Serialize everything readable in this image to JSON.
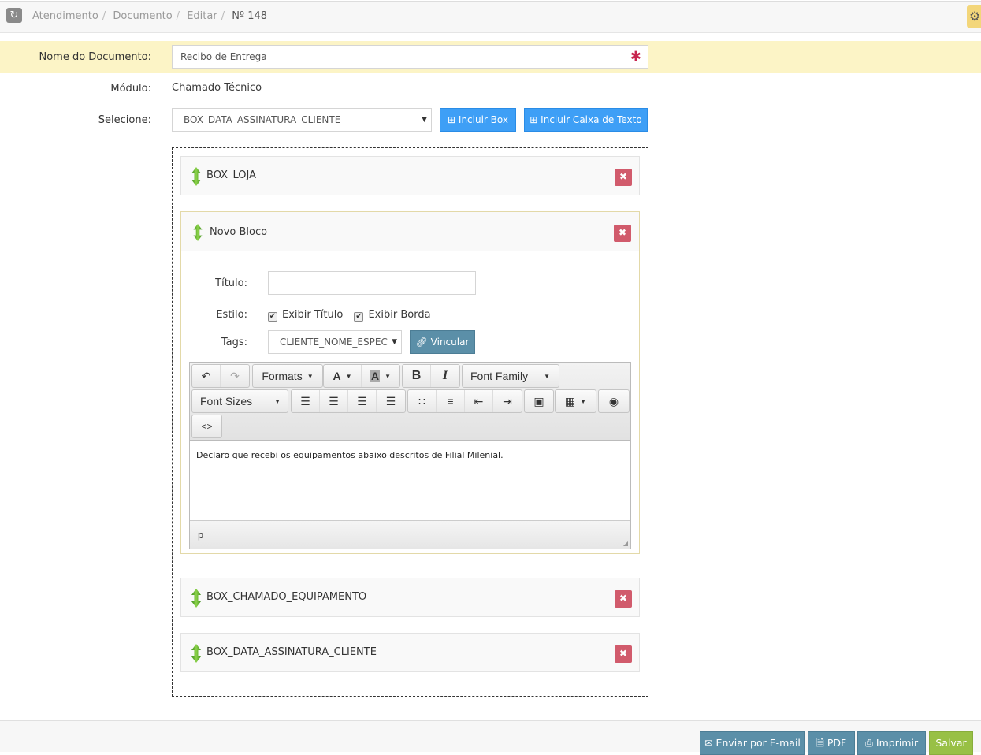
{
  "breadcrumb": {
    "items": [
      "Atendimento",
      "Documento",
      "Editar"
    ],
    "current": "Nº 148"
  },
  "form": {
    "nome_label": "Nome do Documento:",
    "nome_value": "Recibo de Entrega",
    "modulo_label": "Módulo:",
    "modulo_value": "Chamado Técnico",
    "selecione_label": "Selecione:",
    "selecione_value": "BOX_DATA_ASSINATURA_CLIENTE",
    "incluir_box": "Incluir Box",
    "incluir_texto": "Incluir Caixa de Texto"
  },
  "boxes": [
    {
      "title": "BOX_LOJA"
    },
    {
      "title": "Novo Bloco"
    },
    {
      "title": "BOX_CHAMADO_EQUIPAMENTO"
    },
    {
      "title": "BOX_DATA_ASSINATURA_CLIENTE"
    }
  ],
  "bloco": {
    "titulo_label": "Título:",
    "titulo_value": "",
    "estilo_label": "Estilo:",
    "exibir_titulo": "Exibir Título",
    "exibir_borda": "Exibir Borda",
    "exibir_titulo_checked": true,
    "exibir_borda_checked": true,
    "tags_label": "Tags:",
    "tags_value": "CLIENTE_NOME_ESPEC",
    "vincular": "Vincular"
  },
  "editor": {
    "formats": "Formats",
    "font_family": "Font Family",
    "font_sizes": "Font Sizes",
    "content": "Declaro que recebi os equipamentos abaixo descritos de Filial Milenial.",
    "path": "p"
  },
  "footer": {
    "email": "Enviar por E-mail",
    "pdf": "PDF",
    "imprimir": "Imprimir",
    "salvar": "Salvar"
  },
  "colors": {
    "primary": "#3e9ff6",
    "secondary": "#5b8fa8",
    "success": "#98c045",
    "danger": "#d15b6c",
    "highlight": "#fcf4c6"
  }
}
